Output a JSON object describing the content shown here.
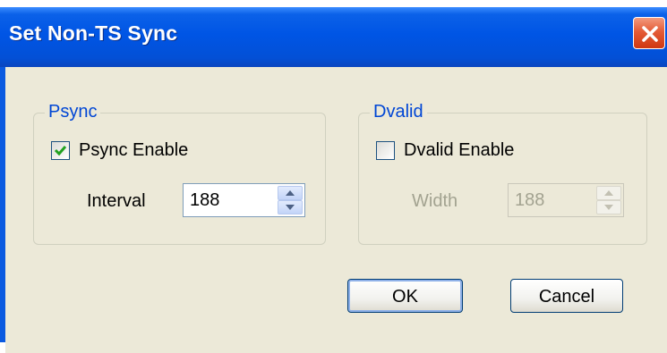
{
  "window": {
    "title": "Set Non-TS Sync"
  },
  "icons": {
    "close": "close-x-icon",
    "check": "checkmark-icon",
    "spin_up": "triangle-up-icon",
    "spin_down": "triangle-down-icon"
  },
  "psync": {
    "group_label": "Psync",
    "enable_label": "Psync Enable",
    "enable_checked": true,
    "interval_label": "Interval",
    "interval_value": "188"
  },
  "dvalid": {
    "group_label": "Dvalid",
    "enable_label": "Dvalid Enable",
    "enable_checked": false,
    "width_label": "Width",
    "width_value": "188",
    "width_enabled": false
  },
  "buttons": {
    "ok": "OK",
    "cancel": "Cancel"
  },
  "colors": {
    "title_bar": "#0055e5",
    "client_bg": "#ece9d8",
    "group_label": "#0046d5",
    "disabled_text": "#a3a391",
    "check_mark": "#21a121",
    "close_button": "#e45b36"
  }
}
